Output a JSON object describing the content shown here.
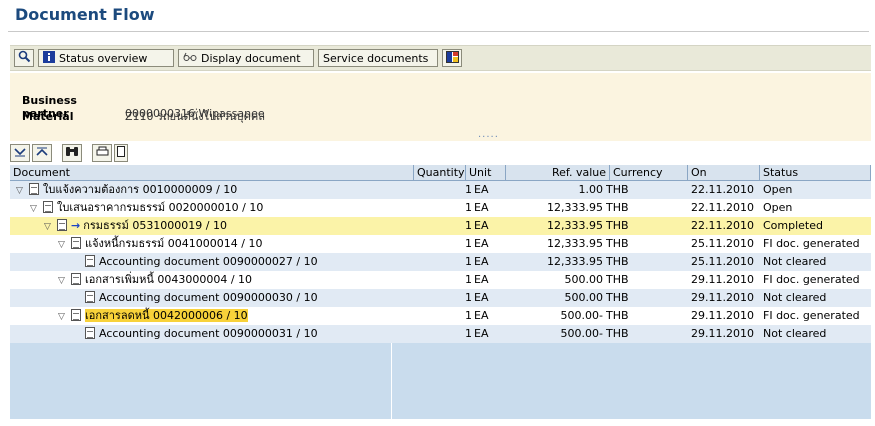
{
  "page": {
    "title": "Document Flow"
  },
  "toolbar": {
    "buttons": [
      {
        "label": "",
        "icon": "magnifier-icon"
      },
      {
        "label": "Status overview",
        "icon": "info-icon"
      },
      {
        "label": "Display document",
        "icon": "glasses-icon"
      },
      {
        "label": "Service documents",
        "icon": ""
      },
      {
        "label": "",
        "icon": "grid-icon"
      }
    ]
  },
  "header": {
    "partner_label": "Business partner",
    "partner_value": "0000000316 Wipassanee",
    "material_label": "Material",
    "material_value": "Z110 รถยนต์นั่งไปส่วนบุคคล",
    "dots": "....."
  },
  "columns": [
    "Document",
    "Quantity",
    "Unit",
    "Ref. value",
    "Currency",
    "On",
    "Status"
  ],
  "rows": [
    {
      "indent": 0,
      "tree": "open",
      "doc": "ใบแจ้งความต้องการ 0010000009 / 10",
      "qty": "1",
      "unit": "EA",
      "ref": "1.00",
      "cur": "THB",
      "on": "22.11.2010",
      "status": "Open",
      "current": false,
      "highlight": false
    },
    {
      "indent": 1,
      "tree": "open",
      "doc": "ใบเสนอราคากรมธรรม์ 0020000010 / 10",
      "qty": "1",
      "unit": "EA",
      "ref": "12,333.95",
      "cur": "THB",
      "on": "22.11.2010",
      "status": "Open",
      "current": false,
      "highlight": false
    },
    {
      "indent": 2,
      "tree": "open",
      "doc": "กรมธรรม์ 0531000019 / 10",
      "qty": "1",
      "unit": "EA",
      "ref": "12,333.95",
      "cur": "THB",
      "on": "22.11.2010",
      "status": "Completed",
      "current": true,
      "highlight": false
    },
    {
      "indent": 3,
      "tree": "open",
      "doc": "แจ้งหนี้กรมธรรม์ 0041000014 / 10",
      "qty": "1",
      "unit": "EA",
      "ref": "12,333.95",
      "cur": "THB",
      "on": "25.11.2010",
      "status": "FI doc. generated",
      "current": false,
      "highlight": false
    },
    {
      "indent": 4,
      "tree": "leaf",
      "doc": "Accounting document 0090000027 / 10",
      "qty": "1",
      "unit": "EA",
      "ref": "12,333.95",
      "cur": "THB",
      "on": "25.11.2010",
      "status": "Not cleared",
      "current": false,
      "highlight": false
    },
    {
      "indent": 3,
      "tree": "open",
      "doc": "เอกสารเพิ่มหนี้ 0043000004 / 10",
      "qty": "1",
      "unit": "EA",
      "ref": "500.00",
      "cur": "THB",
      "on": "29.11.2010",
      "status": "FI doc. generated",
      "current": false,
      "highlight": false
    },
    {
      "indent": 4,
      "tree": "leaf",
      "doc": "Accounting document 0090000030 / 10",
      "qty": "1",
      "unit": "EA",
      "ref": "500.00",
      "cur": "THB",
      "on": "29.11.2010",
      "status": "Not cleared",
      "current": false,
      "highlight": false
    },
    {
      "indent": 3,
      "tree": "open",
      "doc": "เอกสารลดหนี้ 0042000006 / 10",
      "qty": "1",
      "unit": "EA",
      "ref": "500.00-",
      "cur": "THB",
      "on": "29.11.2010",
      "status": "FI doc. generated",
      "current": false,
      "highlight": true
    },
    {
      "indent": 4,
      "tree": "leaf",
      "doc": "Accounting document 0090000031 / 10",
      "qty": "1",
      "unit": "EA",
      "ref": "500.00-",
      "cur": "THB",
      "on": "29.11.2010",
      "status": "Not cleared",
      "current": false,
      "highlight": false
    }
  ],
  "colors": {
    "row_a": "#e1eaf4",
    "row_b": "#ffffff",
    "current_row": "#fbf3a8",
    "highlight": "#f8d23a",
    "title": "#1c4a7e"
  }
}
